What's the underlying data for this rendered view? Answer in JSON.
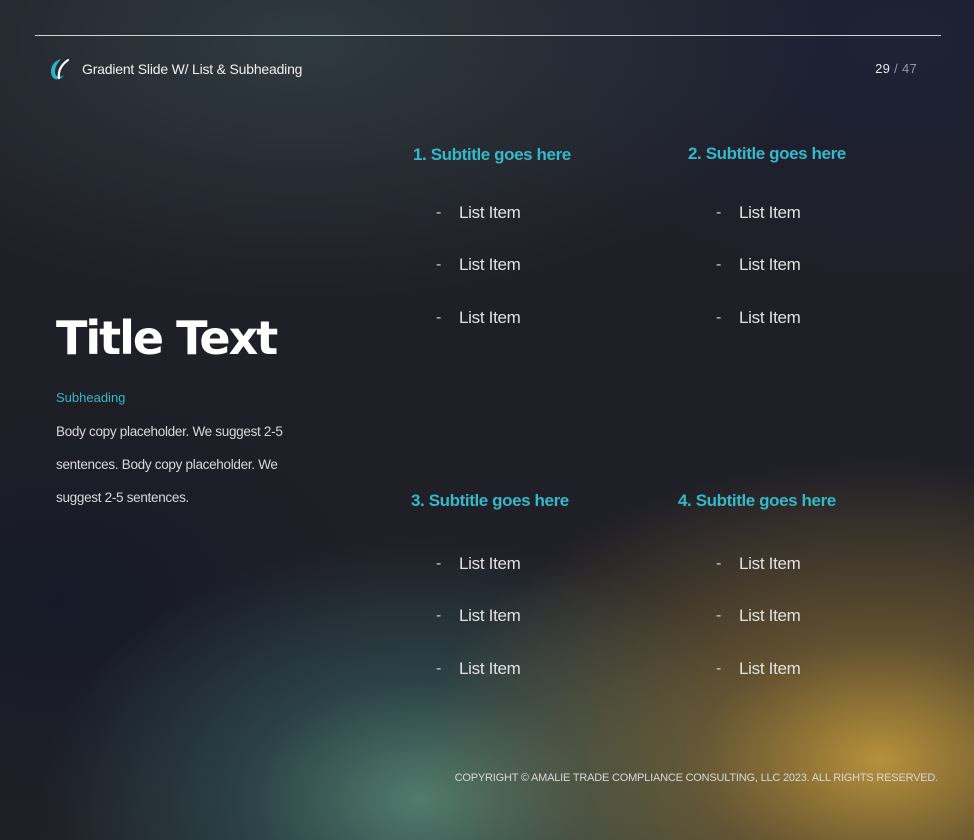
{
  "header": {
    "title": "Gradient Slide W/ List & Subheading"
  },
  "page": {
    "current": "29",
    "separator": "/",
    "total": "47"
  },
  "left": {
    "title": "Title Text",
    "subheading": "Subheading",
    "body": "Body copy placeholder. We suggest 2-5 sentences. Body copy placeholder. We suggest 2-5 sentences."
  },
  "sections": [
    {
      "subtitle": "1. Subtitle goes here",
      "items": [
        "List Item",
        "List Item",
        "List Item"
      ]
    },
    {
      "subtitle": "2. Subtitle goes here",
      "items": [
        "List Item",
        "List Item",
        "List Item"
      ]
    },
    {
      "subtitle": "3. Subtitle goes here",
      "items": [
        "List Item",
        "List Item",
        "List Item"
      ]
    },
    {
      "subtitle": "4. Subtitle goes here",
      "items": [
        "List Item",
        "List Item",
        "List Item"
      ]
    }
  ],
  "list_marker": "-",
  "footer": {
    "copyright": "COPYRIGHT © AMALIE TRADE COMPLIANCE CONSULTING, LLC 2023. ALL RIGHTS RESERVED."
  },
  "colors": {
    "accent": "#35b8c8",
    "text": "#e2e2e2",
    "title": "#ffffff"
  },
  "icons": {
    "logo": "swoosh-logo-icon"
  }
}
